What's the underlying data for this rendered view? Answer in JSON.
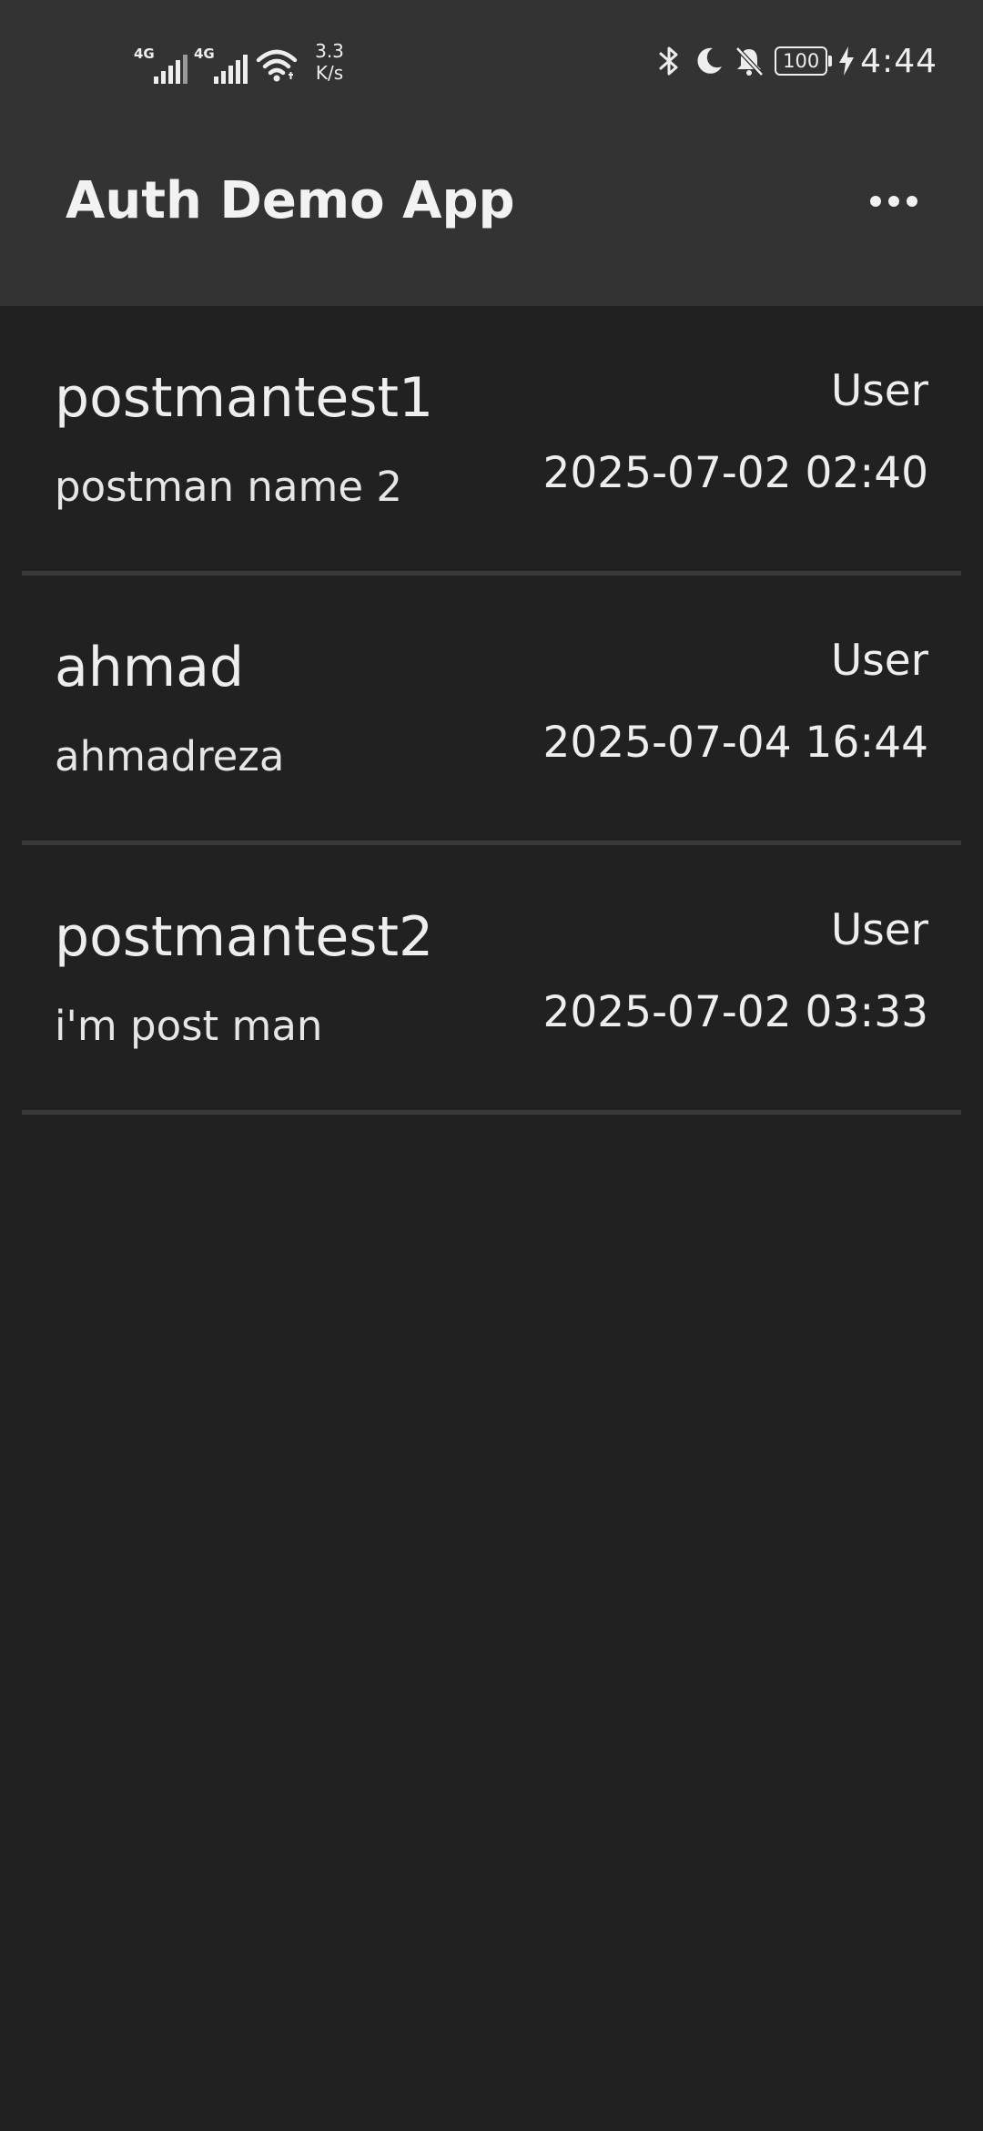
{
  "status_bar": {
    "signal_1_tag": "4G",
    "signal_2_tag": "4G",
    "net_speed_value": "3.3",
    "net_speed_unit": "K/s",
    "battery_level": "100",
    "time": "4:44",
    "icons": [
      "signal-icon",
      "signal-icon",
      "wifi-icon",
      "bluetooth-icon",
      "moon-icon",
      "bell-off-icon",
      "battery-icon",
      "charging-bolt-icon"
    ]
  },
  "app_bar": {
    "title": "Auth Demo App",
    "overflow_icon": "more-horizontal-icon"
  },
  "users": [
    {
      "username": "postmantest1",
      "full_name": "postman name 2",
      "role": "User",
      "date": "2025-07-02 02:40"
    },
    {
      "username": "ahmad",
      "full_name": "ahmadreza",
      "role": "User",
      "date": "2025-07-04 16:44"
    },
    {
      "username": "postmantest2",
      "full_name": "i'm post man",
      "role": "User",
      "date": "2025-07-02 03:33"
    }
  ],
  "colors": {
    "background": "#212121",
    "app_bar": "#333333",
    "divider": "#3a3a3a",
    "text": "#eeeeee"
  }
}
